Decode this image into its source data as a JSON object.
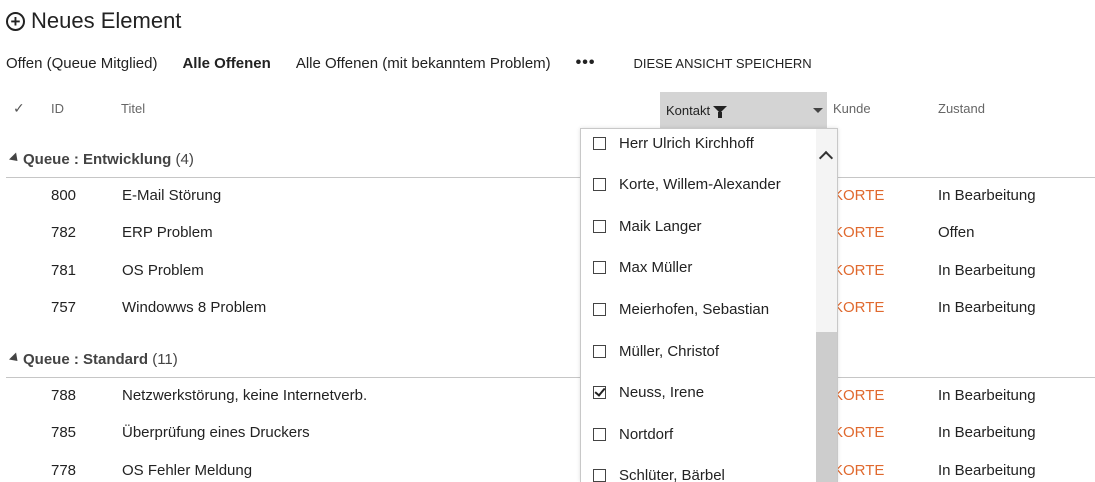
{
  "new_item": {
    "label": "Neues Element",
    "icon": "plus-circle-icon"
  },
  "views": {
    "items": [
      "Offen (Queue Mitglied)",
      "Alle Offenen",
      "Alle Offenen (mit bekanntem Problem)"
    ],
    "active_index": 1,
    "more": "•••",
    "save_view": "DIESE ANSICHT SPEICHERN"
  },
  "columns": {
    "check": "✓",
    "id": "ID",
    "title": "Titel",
    "contact": "Kontakt",
    "customer": "Kunde",
    "state": "Zustand"
  },
  "groups": [
    {
      "name": "Queue : Entwicklung",
      "count": "(4)",
      "rows": [
        {
          "id": "800",
          "title": "E-Mail Störung",
          "customer": "KORTE",
          "state": "In Bearbeitung"
        },
        {
          "id": "782",
          "title": "ERP Problem",
          "customer": "KORTE",
          "state": "Offen"
        },
        {
          "id": "781",
          "title": "OS Problem",
          "customer": "KORTE",
          "state": "In Bearbeitung"
        },
        {
          "id": "757",
          "title": "Windowws 8 Problem",
          "customer": "KORTE",
          "state": "In Bearbeitung"
        }
      ]
    },
    {
      "name": "Queue : Standard",
      "count": "(11)",
      "rows": [
        {
          "id": "788",
          "title": "Netzwerkstörung, keine Internetverb.",
          "customer": "KORTE",
          "state": "In Bearbeitung"
        },
        {
          "id": "785",
          "title": "Überprüfung eines Druckers",
          "customer": "KORTE",
          "state": "In Bearbeitung"
        },
        {
          "id": "778",
          "title": "OS Fehler Meldung",
          "customer": "KORTE",
          "state": "In Bearbeitung"
        }
      ]
    }
  ],
  "contact_filter": {
    "options": [
      {
        "label": "Herr Ulrich Kirchhoff",
        "checked": false
      },
      {
        "label": "Korte, Willem-Alexander",
        "checked": false
      },
      {
        "label": "Maik Langer",
        "checked": false
      },
      {
        "label": "Max Müller",
        "checked": false
      },
      {
        "label": "Meierhofen, Sebastian",
        "checked": false
      },
      {
        "label": "Müller, Christof",
        "checked": false
      },
      {
        "label": "Neuss, Irene",
        "checked": true
      },
      {
        "label": "Nortdorf",
        "checked": false
      },
      {
        "label": "Schlüter, Bärbel",
        "checked": false
      }
    ]
  },
  "colors": {
    "accent": "#e0692e",
    "header_active_bg": "#d4d4d4",
    "rule": "#c6c6c6"
  }
}
